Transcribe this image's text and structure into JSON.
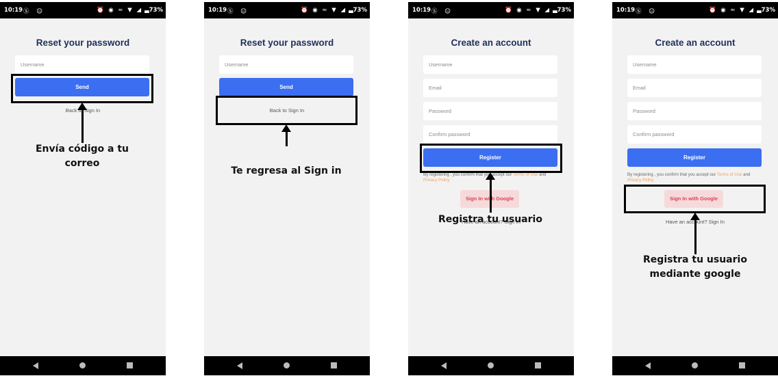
{
  "status_bar": {
    "time": "10:19",
    "left_icons": "Ⓢ ☺",
    "right_icons": "⏰ ◉ ≈ ▼ ◢",
    "battery": "▃73%"
  },
  "screens": [
    {
      "title": "Reset your password",
      "username_placeholder": "Username",
      "send_label": "Send",
      "back_link": "Back to Sign In",
      "annotation": "Envía código a tu correo"
    },
    {
      "title": "Reset your password",
      "username_placeholder": "Username",
      "send_label": "Send",
      "back_link": "Back to Sign In",
      "annotation": "Te regresa al Sign in"
    },
    {
      "title": "Create an account",
      "username_placeholder": "Username",
      "email_placeholder": "Email",
      "password_placeholder": "Password",
      "confirm_placeholder": "Confirm password",
      "register_label": "Register",
      "terms_prefix": "By registering , you confirm that you accept our ",
      "terms_link": "Terms of Use",
      "terms_and": " and ",
      "privacy_link": "Privacy Policy",
      "google_label": "Sign In with Google",
      "have_account": "Have an account? Sign In",
      "annotation": "Registra tu usuario"
    },
    {
      "title": "Create an account",
      "username_placeholder": "Username",
      "email_placeholder": "Email",
      "password_placeholder": "Password",
      "confirm_placeholder": "Confirm password",
      "register_label": "Register",
      "terms_prefix": "By registering , you confirm that you accept our ",
      "terms_link": "Terms of Use",
      "terms_and": " and ",
      "privacy_link": "Privacy Policy",
      "google_label": "Sign In with Google",
      "have_account": "Have an account? Sign In",
      "annotation": "Registra tu usuario mediante google"
    }
  ],
  "colors": {
    "primary": "#3b6ef1",
    "title": "#1e2f5b",
    "google_bg": "#f6dada",
    "google_text": "#d6425b",
    "terms_link": "#f0a060",
    "screen_bg": "#f2f2f2"
  }
}
